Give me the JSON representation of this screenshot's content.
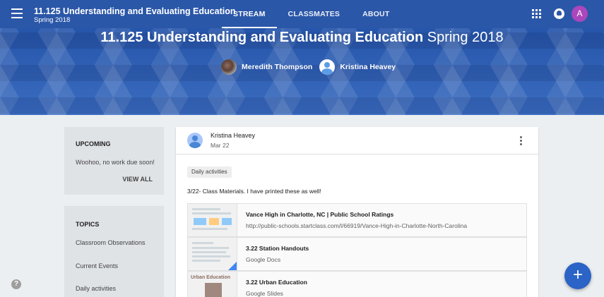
{
  "header": {
    "course_title": "11.125 Understanding and Evaluating Education",
    "course_term": "Spring 2018",
    "tabs": [
      {
        "label": "STREAM",
        "active": true
      },
      {
        "label": "CLASSMATES",
        "active": false
      },
      {
        "label": "ABOUT",
        "active": false
      }
    ],
    "account_initial": "A",
    "account_color": "#ab47bc",
    "accent_color": "#2b57a8"
  },
  "hero": {
    "title_bold": "11.125 Understanding and Evaluating Education",
    "title_light": "Spring 2018",
    "teachers": [
      "Meredith Thompson",
      "Kristina Heavey"
    ]
  },
  "upcoming": {
    "heading": "UPCOMING",
    "message": "Woohoo, no work due soon!",
    "view_all": "VIEW ALL"
  },
  "topics": {
    "heading": "TOPICS",
    "items": [
      "Classroom Observations",
      "Current Events",
      "Daily activities"
    ]
  },
  "post": {
    "author": "Kristina Heavey",
    "date": "Mar 22",
    "topic_chip": "Daily activities",
    "text": "3/22- Class Materials. I have printed these as well!",
    "attachments": [
      {
        "title": "Vance High in Charlotte, NC | Public School Ratings",
        "subtitle": "http://public-schools.startclass.com/l/66919/Vance-High-in-Charlotte-North-Carolina"
      },
      {
        "title": "3.22 Station Handouts",
        "subtitle": "Google Docs"
      },
      {
        "title": "3.22 Urban Education",
        "subtitle": "Google Slides",
        "thumb_text": "Urban Education"
      }
    ]
  },
  "icons": {
    "menu": "menu-icon",
    "apps": "apps-icon",
    "notifications": "bell-icon",
    "more": "more-vert-icon",
    "help": "help-icon",
    "add": "add-icon"
  },
  "help_glyph": "?",
  "fab_glyph": "+"
}
